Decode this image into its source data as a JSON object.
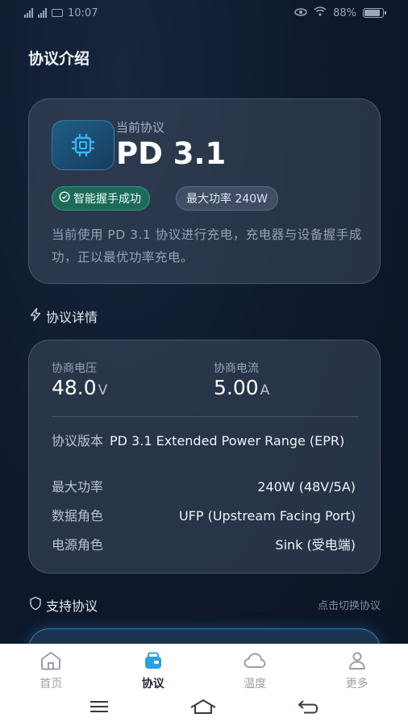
{
  "status_bar": {
    "carrier_left": "⁴⁶ᵢ",
    "carrier_mid": "⁴⁶ᵢ",
    "time": "10:07",
    "battery_text": "88%",
    "battery_level": 0.88
  },
  "page": {
    "title": "协议介绍"
  },
  "current": {
    "label": "当前协议",
    "value": "PD 3.1",
    "icon": "chip-icon",
    "badge_ok": "智能握手成功",
    "badge_power": "最大功率 240W",
    "description": "当前使用 PD 3.1 协议进行充电，充电器与设备握手成功，正以最优功率充电。"
  },
  "details": {
    "section_title": "协议详情",
    "voltage_label": "协商电压",
    "voltage_value": "48.0",
    "voltage_unit": "V",
    "current_label": "协商电流",
    "current_value": "5.00",
    "current_unit": "A",
    "rows": [
      {
        "label": "协议版本",
        "value": "PD 3.1 Extended Power Range (EPR)"
      },
      {
        "label": "最大功率",
        "value": "240W (48V/5A)"
      },
      {
        "label": "数据角色",
        "value": "UFP (Upstream Facing Port)"
      },
      {
        "label": "电源角色",
        "value": "Sink (受电端)"
      }
    ]
  },
  "support": {
    "section_title": "支持协议",
    "link": "点击切换协议"
  },
  "tabs": [
    {
      "label": "首页",
      "icon": "home-icon"
    },
    {
      "label": "协议",
      "icon": "protocol-icon"
    },
    {
      "label": "温度",
      "icon": "cloud-icon"
    },
    {
      "label": "更多",
      "icon": "person-icon"
    }
  ],
  "colors": {
    "accent": "#2f9fe0",
    "success": "#1e6a59",
    "background": "#0f1a2d"
  }
}
